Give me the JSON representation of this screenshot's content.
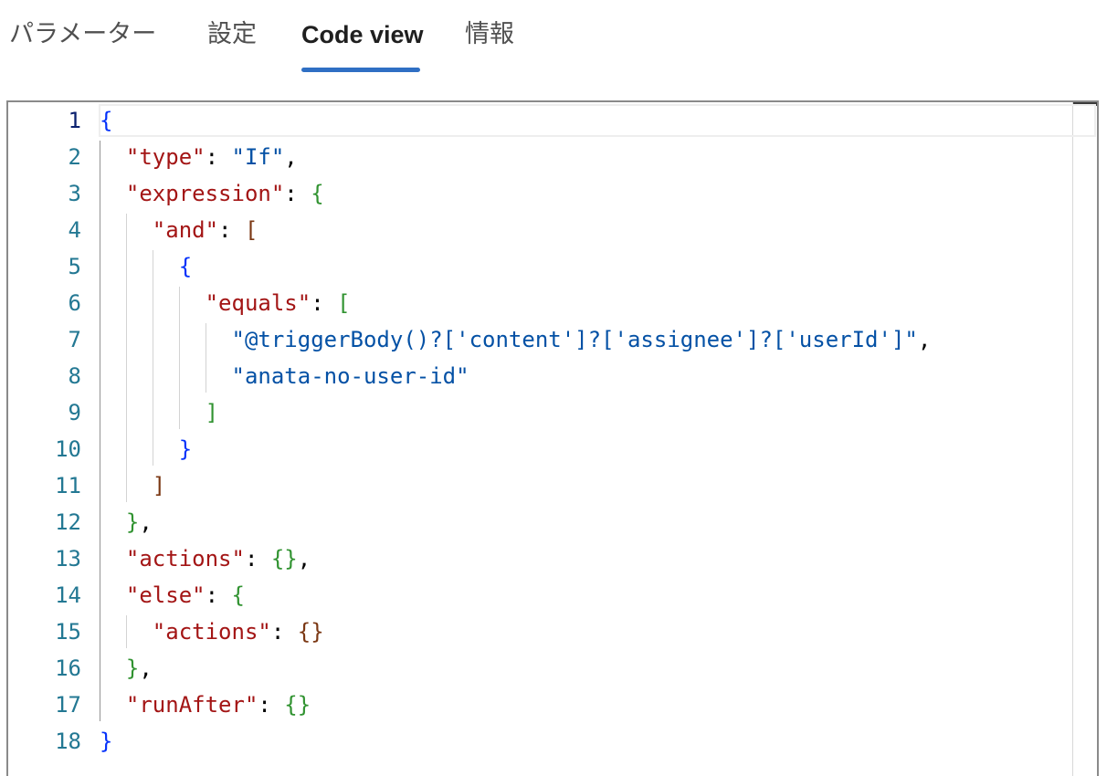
{
  "tabs": [
    {
      "label": "パラメーター",
      "active": false
    },
    {
      "label": "設定",
      "active": false
    },
    {
      "label": "Code view",
      "active": true
    },
    {
      "label": "情報",
      "active": false
    }
  ],
  "colors": {
    "accent": "#2f6fc4",
    "line_number": "#237893",
    "line_number_active": "#0b216f",
    "json_key": "#a31515",
    "json_string": "#0451a5",
    "bracket_level_1": "#0431fa",
    "bracket_level_2": "#319331",
    "bracket_level_3": "#7b3814"
  },
  "editor": {
    "active_line": 1,
    "lines": [
      {
        "n": "1",
        "tokens": [
          {
            "t": "{",
            "c": "b1"
          }
        ]
      },
      {
        "n": "2",
        "tokens": [
          {
            "t": "  \"type\"",
            "c": "k"
          },
          {
            "t": ": ",
            "c": "p"
          },
          {
            "t": "\"If\"",
            "c": "s"
          },
          {
            "t": ",",
            "c": "p"
          }
        ]
      },
      {
        "n": "3",
        "tokens": [
          {
            "t": "  \"expression\"",
            "c": "k"
          },
          {
            "t": ": ",
            "c": "p"
          },
          {
            "t": "{",
            "c": "b2"
          }
        ]
      },
      {
        "n": "4",
        "tokens": [
          {
            "t": "    \"and\"",
            "c": "k"
          },
          {
            "t": ": ",
            "c": "p"
          },
          {
            "t": "[",
            "c": "b3"
          }
        ]
      },
      {
        "n": "5",
        "tokens": [
          {
            "t": "      ",
            "c": "p"
          },
          {
            "t": "{",
            "c": "b1"
          }
        ]
      },
      {
        "n": "6",
        "tokens": [
          {
            "t": "        \"equals\"",
            "c": "k"
          },
          {
            "t": ": ",
            "c": "p"
          },
          {
            "t": "[",
            "c": "b2"
          }
        ]
      },
      {
        "n": "7",
        "tokens": [
          {
            "t": "          \"@triggerBody()?['content']?['assignee']?['userId']\"",
            "c": "s"
          },
          {
            "t": ",",
            "c": "p"
          }
        ]
      },
      {
        "n": "8",
        "tokens": [
          {
            "t": "          \"anata-no-user-id\"",
            "c": "s"
          }
        ]
      },
      {
        "n": "9",
        "tokens": [
          {
            "t": "        ",
            "c": "p"
          },
          {
            "t": "]",
            "c": "b2"
          }
        ]
      },
      {
        "n": "10",
        "tokens": [
          {
            "t": "      ",
            "c": "p"
          },
          {
            "t": "}",
            "c": "b1"
          }
        ]
      },
      {
        "n": "11",
        "tokens": [
          {
            "t": "    ",
            "c": "p"
          },
          {
            "t": "]",
            "c": "b3"
          }
        ]
      },
      {
        "n": "12",
        "tokens": [
          {
            "t": "  ",
            "c": "p"
          },
          {
            "t": "}",
            "c": "b2"
          },
          {
            "t": ",",
            "c": "p"
          }
        ]
      },
      {
        "n": "13",
        "tokens": [
          {
            "t": "  \"actions\"",
            "c": "k"
          },
          {
            "t": ": ",
            "c": "p"
          },
          {
            "t": "{}",
            "c": "b2"
          },
          {
            "t": ",",
            "c": "p"
          }
        ]
      },
      {
        "n": "14",
        "tokens": [
          {
            "t": "  \"else\"",
            "c": "k"
          },
          {
            "t": ": ",
            "c": "p"
          },
          {
            "t": "{",
            "c": "b2"
          }
        ]
      },
      {
        "n": "15",
        "tokens": [
          {
            "t": "    \"actions\"",
            "c": "k"
          },
          {
            "t": ": ",
            "c": "p"
          },
          {
            "t": "{}",
            "c": "b3"
          }
        ]
      },
      {
        "n": "16",
        "tokens": [
          {
            "t": "  ",
            "c": "p"
          },
          {
            "t": "}",
            "c": "b2"
          },
          {
            "t": ",",
            "c": "p"
          }
        ]
      },
      {
        "n": "17",
        "tokens": [
          {
            "t": "  \"runAfter\"",
            "c": "k"
          },
          {
            "t": ": ",
            "c": "p"
          },
          {
            "t": "{}",
            "c": "b2"
          }
        ]
      },
      {
        "n": "18",
        "tokens": [
          {
            "t": "}",
            "c": "b1"
          }
        ]
      }
    ]
  }
}
